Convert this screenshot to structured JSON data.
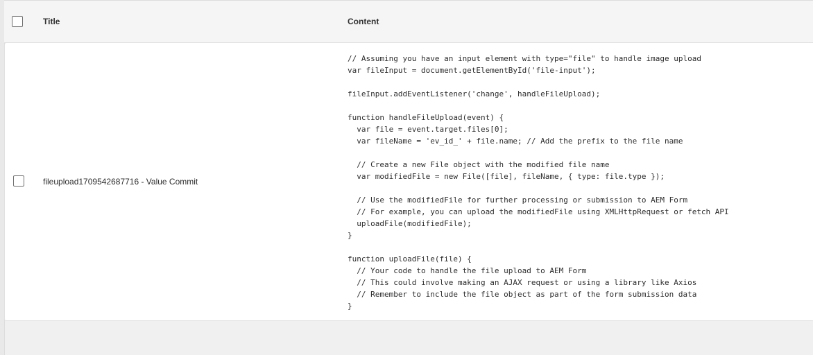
{
  "table": {
    "headers": {
      "title": "Title",
      "content": "Content"
    },
    "rows": [
      {
        "title": "fileupload1709542687716 - Value Commit",
        "content": "// Assuming you have an input element with type=\"file\" to handle image upload\nvar fileInput = document.getElementById('file-input');\n\nfileInput.addEventListener('change', handleFileUpload);\n\nfunction handleFileUpload(event) {\n  var file = event.target.files[0];\n  var fileName = 'ev_id_' + file.name; // Add the prefix to the file name\n\n  // Create a new File object with the modified file name\n  var modifiedFile = new File([file], fileName, { type: file.type });\n\n  // Use the modifiedFile for further processing or submission to AEM Form\n  // For example, you can upload the modifiedFile using XMLHttpRequest or fetch API\n  uploadFile(modifiedFile);\n}\n\nfunction uploadFile(file) {\n  // Your code to handle the file upload to AEM Form\n  // This could involve making an AJAX request or using a library like Axios\n  // Remember to include the file object as part of the form submission data\n}"
      }
    ]
  }
}
